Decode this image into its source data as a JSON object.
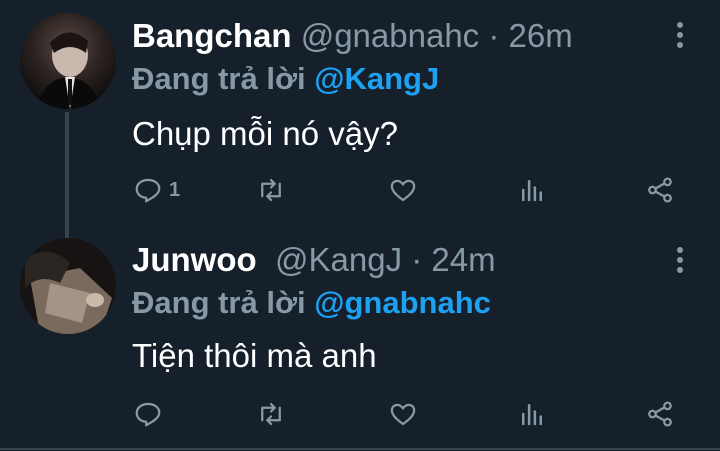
{
  "tweets": [
    {
      "name": "Bangchan",
      "handle": "@gnabnahc",
      "separator": "·",
      "time": "26m",
      "reply_prefix": "Đang trả lời",
      "reply_to": "@KangJ",
      "text": "Chụp mỗi nó vậy?",
      "reply_count": "1"
    },
    {
      "name": "Junwoo",
      "handle": "@KangJ",
      "separator": "·",
      "time": "24m",
      "reply_prefix": "Đang trả lời",
      "reply_to": "@gnabnahc",
      "text": "Tiện thôi mà anh",
      "reply_count": ""
    }
  ],
  "colors": {
    "background": "#15202b",
    "secondary_text": "#8899a6",
    "mention": "#1da1f2",
    "divider": "#38444d"
  },
  "icons": [
    "reply-icon",
    "retweet-icon",
    "like-icon",
    "analytics-icon",
    "share-icon",
    "more-icon"
  ]
}
